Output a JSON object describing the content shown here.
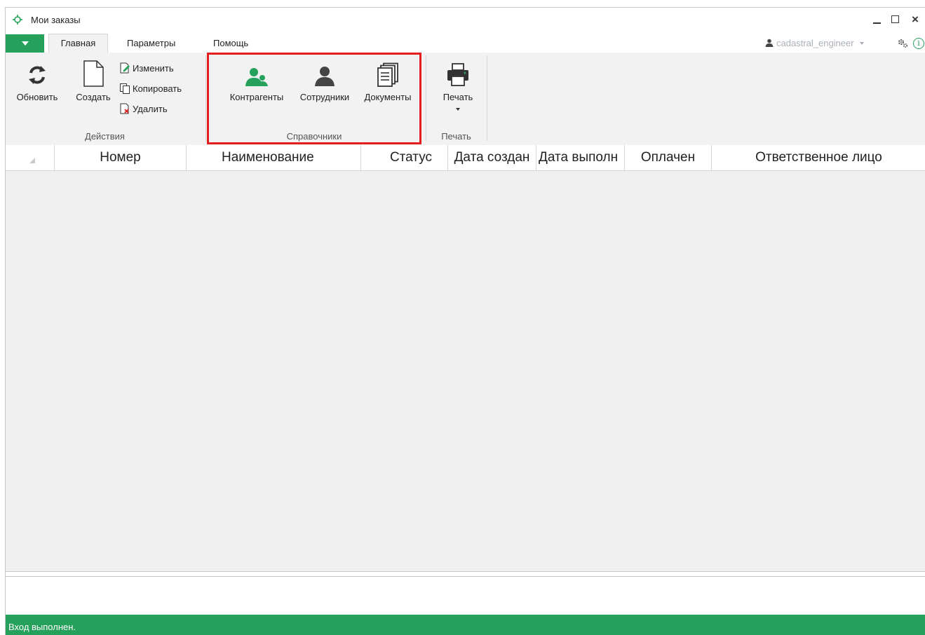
{
  "window": {
    "title": "Мои заказы"
  },
  "tabs": [
    {
      "label": "Главная",
      "active": true
    },
    {
      "label": "Параметры",
      "active": false
    },
    {
      "label": "Помощь",
      "active": false
    }
  ],
  "user": {
    "name": "cadastral_engineer"
  },
  "ribbon": {
    "actions": {
      "label": "Действия",
      "refresh": "Обновить",
      "create": "Создать",
      "edit": "Изменить",
      "copy": "Копировать",
      "delete": "Удалить"
    },
    "references": {
      "label": "Справочники",
      "contractors": "Контрагенты",
      "employees": "Сотрудники",
      "documents": "Документы"
    },
    "print": {
      "label": "Печать",
      "button": "Печать"
    }
  },
  "table": {
    "columns": [
      "Номер",
      "Наименование",
      "Статус",
      "Дата создан",
      "Дата выполн",
      "Оплачен",
      "Ответственное лицо"
    ],
    "rows": []
  },
  "statusbar": {
    "text": "Вход выполнен."
  },
  "colors": {
    "accent": "#26a15c",
    "highlight": "#e41e1e"
  },
  "icons": {
    "app": "crosshair-icon",
    "refresh": "refresh-icon",
    "create": "new-document-icon",
    "edit": "edit-document-icon",
    "copy": "copy-icon",
    "delete": "delete-document-icon",
    "contractors": "users-group-icon",
    "employees": "user-icon",
    "documents": "documents-stack-icon",
    "print": "printer-icon"
  }
}
